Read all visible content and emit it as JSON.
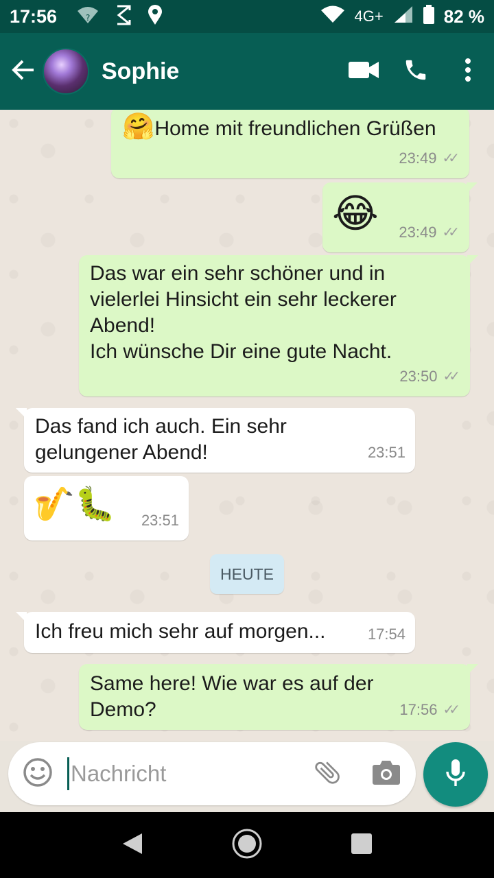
{
  "status_bar": {
    "time": "17:56",
    "network": "4G+",
    "battery": "82 %"
  },
  "header": {
    "contact_name": "Sophie"
  },
  "messages": [
    {
      "dir": "out",
      "text": "Home mit freundlichen Grüßen",
      "emoji": "🤗",
      "time": "23:49",
      "read": true
    },
    {
      "dir": "out",
      "emoji_only": "😂",
      "time": "23:49",
      "read": true
    },
    {
      "dir": "out",
      "lines": [
        "Das war ein sehr schöner und in",
        "vielerlei Hinsicht ein sehr leckerer",
        "Abend!",
        "Ich wünsche Dir eine gute Nacht."
      ],
      "time": "23:50",
      "read": true
    },
    {
      "dir": "in",
      "lines": [
        "Das fand ich auch. Ein sehr",
        "gelungener Abend!"
      ],
      "time": "23:51"
    },
    {
      "dir": "in",
      "emoji_only": "🎷🐛",
      "time": "23:51"
    },
    {
      "dir": "in",
      "text": "Ich freu mich sehr auf morgen...",
      "time": "17:54"
    },
    {
      "dir": "out",
      "lines": [
        "Same here! Wie war es auf der",
        "Demo?"
      ],
      "time": "17:56",
      "read": true
    }
  ],
  "date_divider": "HEUTE",
  "composer": {
    "placeholder": "Nachricht"
  },
  "icons": {
    "back": "arrow-left-icon",
    "video": "video-camera-icon",
    "call": "phone-icon",
    "menu": "more-vert-icon",
    "emoji": "smiley-icon",
    "attach": "paperclip-icon",
    "camera": "camera-icon",
    "mic": "microphone-icon"
  },
  "colors": {
    "header": "#075e54",
    "statusbar": "#054d44",
    "outgoing_bubble": "#dcf8c6",
    "incoming_bubble": "#ffffff",
    "mic_button": "#128c7e",
    "date_pill": "#d4eaf4"
  }
}
